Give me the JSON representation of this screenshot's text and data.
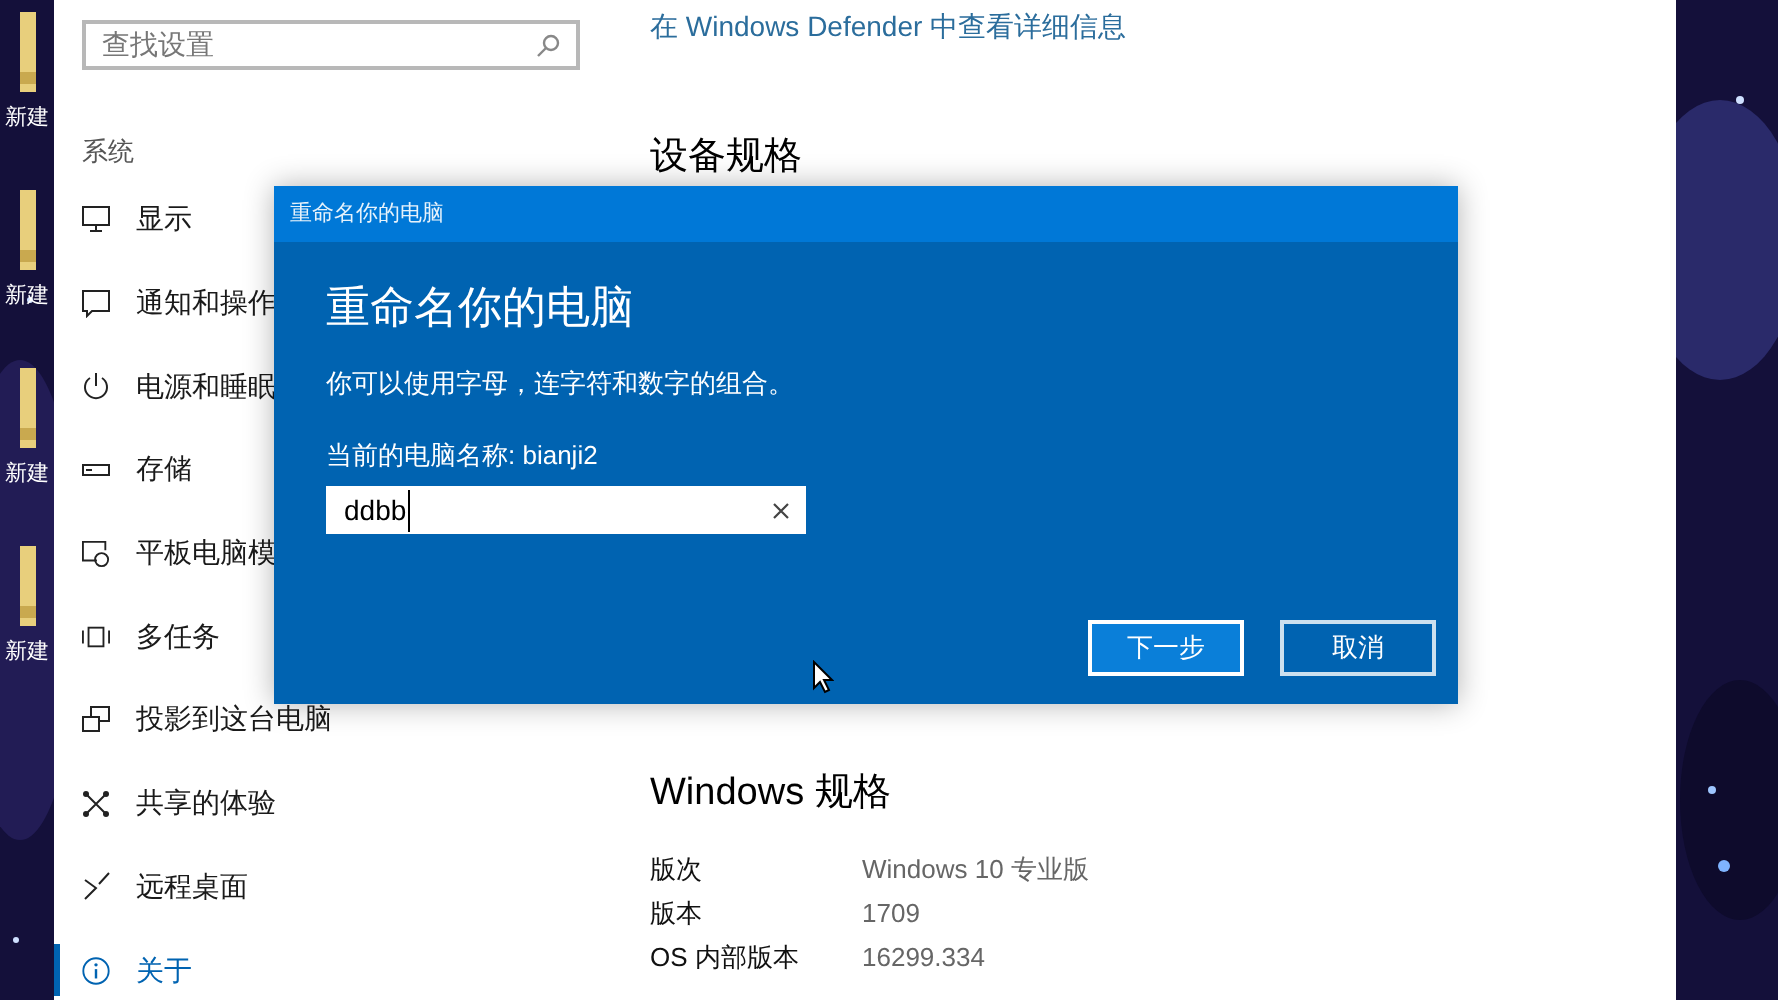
{
  "desktop_icons": [
    {
      "label": "新建"
    },
    {
      "label": "新建"
    },
    {
      "label": "新建"
    },
    {
      "label": "新建"
    }
  ],
  "search": {
    "placeholder": "查找设置"
  },
  "sidebar": {
    "heading": "系统",
    "items": [
      {
        "label": "显示",
        "selected": false
      },
      {
        "label": "通知和操作",
        "selected": false
      },
      {
        "label": "电源和睡眠",
        "selected": false
      },
      {
        "label": "存储",
        "selected": false
      },
      {
        "label": "平板电脑模",
        "selected": false
      },
      {
        "label": "多任务",
        "selected": false
      },
      {
        "label": "投影到这台电脑",
        "selected": false
      },
      {
        "label": "共享的体验",
        "selected": false
      },
      {
        "label": "远程桌面",
        "selected": false
      },
      {
        "label": "关于",
        "selected": true
      }
    ]
  },
  "content": {
    "link": "在 Windows Defender 中查看详细信息",
    "device_heading": "设备规格",
    "windows_spec": {
      "heading": "Windows 规格",
      "rows": [
        {
          "label": "版次",
          "value": "Windows 10 专业版"
        },
        {
          "label": "版本",
          "value": "1709"
        },
        {
          "label": "OS 内部版本",
          "value": "16299.334"
        }
      ]
    }
  },
  "dialog": {
    "title": "重命名你的电脑",
    "heading": "重命名你的电脑",
    "description": "你可以使用字母，连字符和数字的组合。",
    "current_name": "当前的电脑名称: bianji2",
    "input": {
      "value": "ddbb"
    },
    "buttons": [
      {
        "label": "下一步",
        "focused": true
      },
      {
        "label": "取消",
        "focused": false
      }
    ]
  }
}
